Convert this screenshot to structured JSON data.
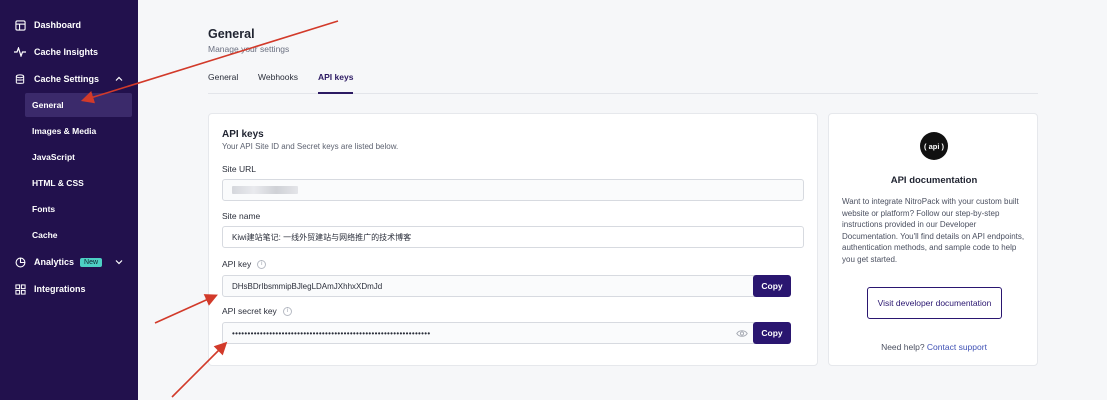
{
  "sidebar": {
    "items": [
      {
        "label": "Dashboard",
        "icon": "dashboard-icon"
      },
      {
        "label": "Cache Insights",
        "icon": "pulse-icon"
      },
      {
        "label": "Cache Settings",
        "icon": "database-icon"
      },
      {
        "label": "Analytics",
        "icon": "chart-pie-icon",
        "badge": "New"
      },
      {
        "label": "Integrations",
        "icon": "grid-icon"
      }
    ],
    "cache_settings_sub": [
      "General",
      "Images & Media",
      "JavaScript",
      "HTML & CSS",
      "Fonts",
      "Cache"
    ],
    "active_sub": "General"
  },
  "header": {
    "title": "General",
    "subtitle": "Manage your settings"
  },
  "tabs": [
    {
      "label": "General"
    },
    {
      "label": "Webhooks"
    },
    {
      "label": "API keys",
      "active": true
    }
  ],
  "api_keys": {
    "title": "API keys",
    "subtitle": "Your API Site ID and Secret keys are listed below.",
    "site_url_label": "Site URL",
    "site_name_label": "Site name",
    "site_name_value": "Kiwi建站笔记: 一线外贸建站与网络推广的技术博客",
    "api_key_label": "API key",
    "api_key_value": "DHsBDrIbsmmipBJlegLDAmJXhhxXDmJd",
    "api_secret_label": "API secret key",
    "api_secret_value": "••••••••••••••••••••••••••••••••••••••••••••••••••••••••••••••••",
    "copy_label": "Copy"
  },
  "docs": {
    "logo_text": "( api )",
    "title": "API documentation",
    "description": "Want to integrate NitroPack with your custom built website or platform? Follow our step-by-step instructions provided in our Developer Documentation. You'll find details on API endpoints, authentication methods, and sample code to help you get started.",
    "button_label": "Visit developer documentation",
    "help_text": "Need help?",
    "help_link": "Contact support"
  },
  "colors": {
    "sidebar_bg": "#22114d",
    "primary": "#2a1670",
    "badge": "#4dd0c4",
    "annotation_arrow": "#d23a2a"
  }
}
